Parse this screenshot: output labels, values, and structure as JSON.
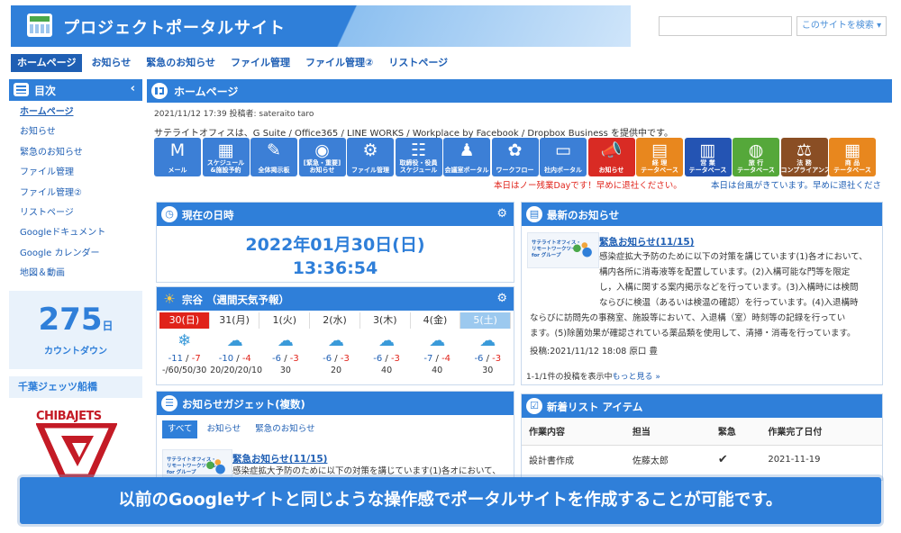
{
  "header": {
    "title": "プロジェクトポータルサイト",
    "search_placeholder": "",
    "search_button": "このサイトを検索 ▾"
  },
  "nav": {
    "tabs": [
      "ホームページ",
      "お知らせ",
      "緊急のお知らせ",
      "ファイル管理",
      "ファイル管理②",
      "リストページ"
    ],
    "active": 0
  },
  "sidebar": {
    "title": "目次",
    "collapse": "‹",
    "items": [
      "ホームページ",
      "お知らせ",
      "緊急のお知らせ",
      "ファイル管理",
      "ファイル管理②",
      "リストページ",
      "Googleドキュメント",
      "Google カレンダー",
      "地図＆動画"
    ],
    "countdown_value": "275",
    "countdown_unit": "日",
    "countdown_label": "カウントダウン",
    "team_heading": "千葉ジェッツ船橋",
    "team_logo_text": "CHIBAJETS"
  },
  "page": {
    "title": "ホームページ",
    "meta": "2021/11/12 17:39 投稿者: sateraito taro",
    "intro": "サテライトオフィスは、G Suite / Office365 / LINE WORKS / Workplace by Facebook / Dropbox Business を提供中です。"
  },
  "apps": [
    {
      "label": "メール",
      "glyph": "M",
      "color": "#3c7fd6"
    },
    {
      "label": "スケジュール\n&施設予約",
      "glyph": "▦",
      "color": "#3c7fd6"
    },
    {
      "label": "全体掲示板",
      "glyph": "✎",
      "color": "#3c7fd6"
    },
    {
      "label": "[緊急・重要]\nお知らせ",
      "glyph": "◉",
      "color": "#3c7fd6"
    },
    {
      "label": "ファイル管理",
      "glyph": "⚙",
      "color": "#3c7fd6"
    },
    {
      "label": "取締役・役員\nスケジュール",
      "glyph": "☷",
      "color": "#3c7fd6"
    },
    {
      "label": "会議室ポータル",
      "glyph": "♟",
      "color": "#3c7fd6"
    },
    {
      "label": "ワークフロー",
      "glyph": "✿",
      "color": "#3c7fd6"
    },
    {
      "label": "社内ポータル",
      "glyph": "▭",
      "color": "#3c7fd6"
    },
    {
      "label": "お知らせ",
      "glyph": "📣",
      "color": "#d92b24"
    },
    {
      "label": "経 理\nテータベース",
      "glyph": "▤",
      "color": "#e8871e"
    },
    {
      "label": "営 業\nテータベース",
      "glyph": "▥",
      "color": "#2454b3"
    },
    {
      "label": "旅 行\nテータベース",
      "glyph": "◍",
      "color": "#55a83a"
    },
    {
      "label": "法 務\nコンプライアンス",
      "glyph": "⚖",
      "color": "#8a4e24"
    },
    {
      "label": "商 品\nテータベース",
      "glyph": "▦",
      "color": "#e8871e"
    }
  ],
  "notices": {
    "left": "本日はノー残業Dayです！早めに退社ください。",
    "right": "本日は台風がきています。早めに退社くださ"
  },
  "clock_panel": {
    "title": "現在の日時",
    "date": "2022年01月30日(日)",
    "time": "13:36:54"
  },
  "weather_panel": {
    "title": "宗谷 （週間天気予報）",
    "days": [
      {
        "label": "30(日)",
        "icon": "❄",
        "hi": "-11",
        "lo": "-7",
        "rain": "-/60/50/30",
        "style": "red"
      },
      {
        "label": "31(月)",
        "icon": "☁",
        "hi": "-10",
        "lo": "-4",
        "rain": "20/20/20/10",
        "style": ""
      },
      {
        "label": "1(火)",
        "icon": "☁",
        "hi": "-6",
        "lo": "-3",
        "rain": "30",
        "style": ""
      },
      {
        "label": "2(水)",
        "icon": "☁",
        "hi": "-6",
        "lo": "-3",
        "rain": "20",
        "style": ""
      },
      {
        "label": "3(木)",
        "icon": "☁",
        "hi": "-6",
        "lo": "-3",
        "rain": "40",
        "style": ""
      },
      {
        "label": "4(金)",
        "icon": "☁",
        "hi": "-7",
        "lo": "-4",
        "rain": "40",
        "style": ""
      },
      {
        "label": "5(土)",
        "icon": "☁",
        "hi": "-6",
        "lo": "-3",
        "rain": "30",
        "style": "blue"
      }
    ]
  },
  "news_gadget": {
    "title": "お知らせガジェット(複数)",
    "tabs": [
      "すべて",
      "お知らせ",
      "緊急のお知らせ"
    ],
    "item_title": "緊急お知らせ(11/15)",
    "item_body": "感染症拡大予防のために以下の対策を講じています(1)各オにおいて、",
    "thumb_text": "サテライトオフィス・\nリモートワークツール\nfor グループ"
  },
  "latest_news": {
    "title": "最新のお知らせ",
    "item_title": "緊急お知らせ(11/15)",
    "body_lines": [
      "感染症拡大予防のために以下の対策を講じています(1)各オにおいて、",
      "構内各所に消毒液等を配置しています。(2)入構可能な門等を限定",
      "し，入構に関する案内掲示などを行っています。(3)入構時には検問",
      "ならびに検温（あるいは検温の確認）を行っています。(4)入退構時",
      "ならびに訪問先の事務室、施設等において、入退構（室）時刻等の記録を行ってい",
      "ます。(5)除菌効果が確認されている薬品類を使用して、清掃・消毒を行っています。"
    ],
    "post": "投稿:2021/11/12 18:08 原口 豊",
    "pager_text": "1-1/1件の投稿を表示中",
    "more": "もっと見る »",
    "thumb_text": "サテライトオフィス・\nリモートワークツール\nfor グループ"
  },
  "new_list": {
    "title": "新着リスト アイテム",
    "columns": [
      "作業内容",
      "担当",
      "緊急",
      "作業完了日付"
    ],
    "rows": [
      [
        "設計書作成",
        "佐藤太郎",
        "✔",
        "2021-11-19"
      ]
    ]
  },
  "caption": "以前のGoogleサイトと同じような操作感でポータルサイトを作成することが可能です。"
}
